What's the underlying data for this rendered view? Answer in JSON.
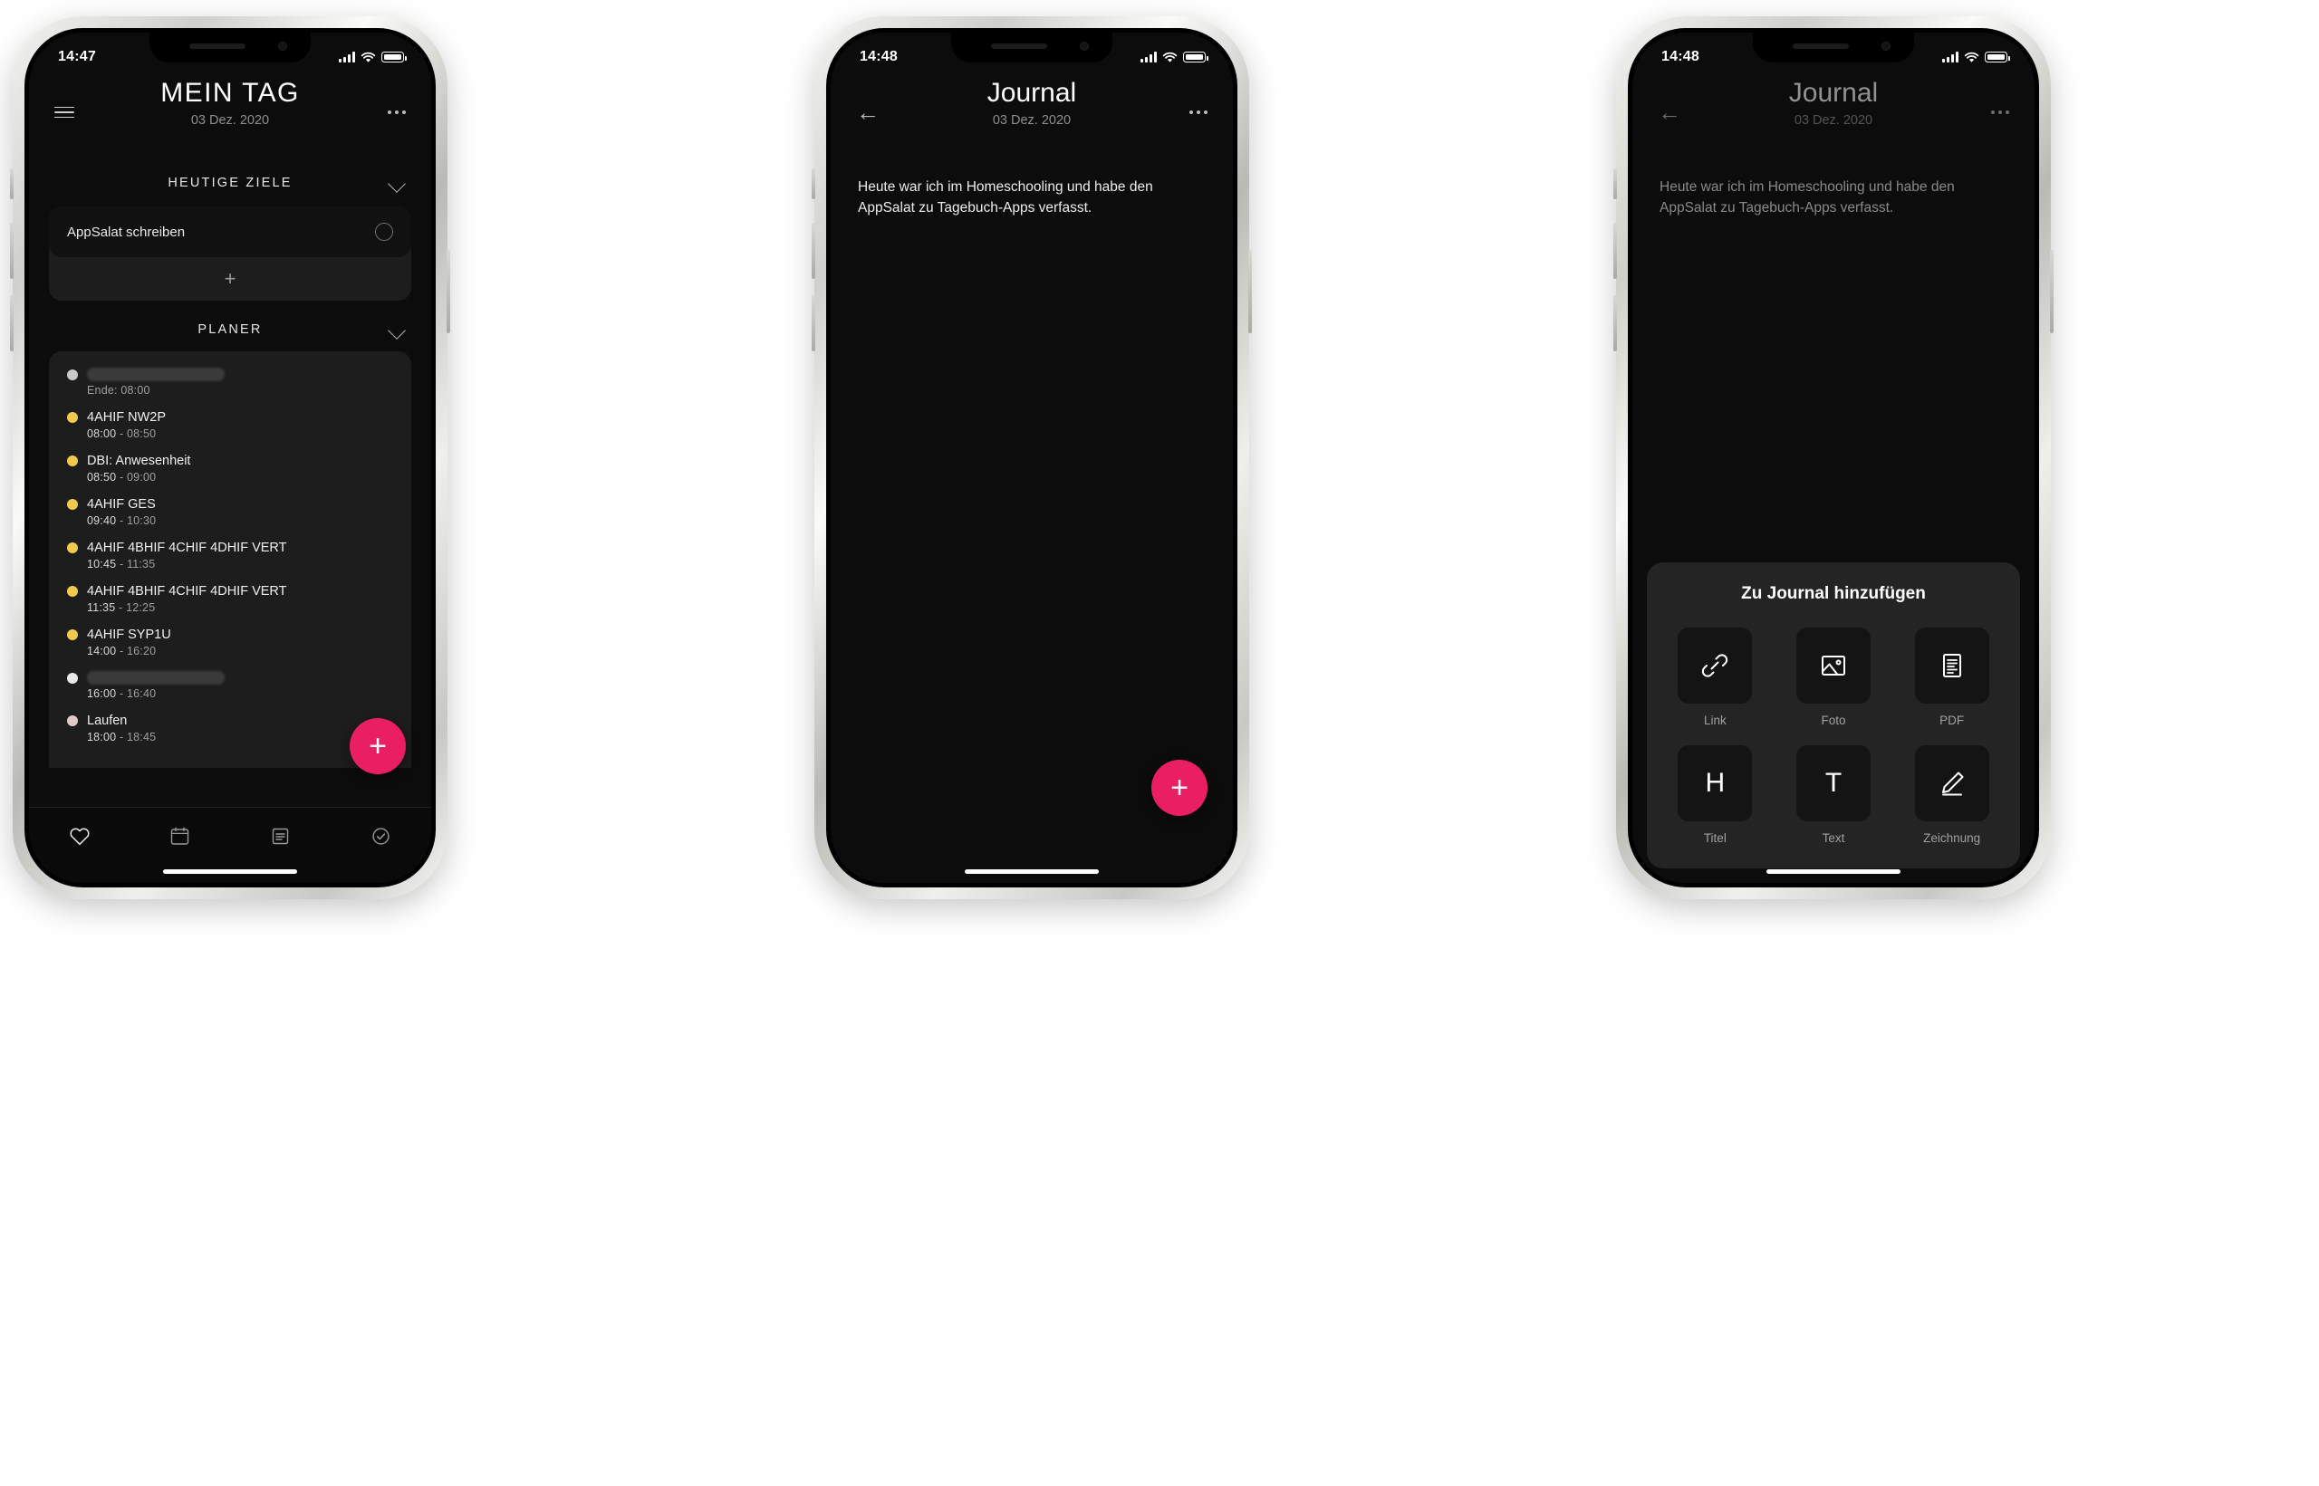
{
  "phones": [
    {
      "id": "phone-mein-tag",
      "status": {
        "time": "14:47",
        "signal_icon": "cellular-bars-icon",
        "wifi_icon": "wifi-icon",
        "battery_icon": "battery-icon"
      },
      "nav": {
        "left_icon": "hamburger-menu-icon",
        "title": "MEIN TAG",
        "subtitle": "03 Dez. 2020",
        "right_icon": "more-options-icon"
      },
      "sections": [
        {
          "key": "goals",
          "title": "HEUTIGE ZIELE",
          "collapse_icon": "chevron-down-icon"
        },
        {
          "key": "planner",
          "title": "PLANER",
          "collapse_icon": "chevron-down-icon"
        }
      ],
      "goals": {
        "items": [
          {
            "label": "AppSalat schreiben",
            "checkbox_icon": "circle-unchecked-icon",
            "done": false
          }
        ],
        "add_label": "+"
      },
      "planner": {
        "events": [
          {
            "title": "",
            "redacted": true,
            "redacted_width": "wide",
            "time": "Ende: 08:00",
            "start": "",
            "end": "",
            "dot": "#c9c9c9",
            "time_plain": true
          },
          {
            "title": "4AHIF NW2P",
            "redacted": false,
            "start": "08:00",
            "end": "08:50",
            "dot": "#f2c94c"
          },
          {
            "title": "DBI: Anwesenheit",
            "redacted": false,
            "start": "08:50",
            "end": "09:00",
            "dot": "#f2c94c"
          },
          {
            "title": "4AHIF GES",
            "redacted": false,
            "start": "09:40",
            "end": "10:30",
            "dot": "#f2c94c"
          },
          {
            "title": "4AHIF 4BHIF 4CHIF 4DHIF VERT",
            "redacted": false,
            "start": "10:45",
            "end": "11:35",
            "dot": "#f2c94c"
          },
          {
            "title": "4AHIF 4BHIF 4CHIF 4DHIF VERT",
            "redacted": false,
            "start": "11:35",
            "end": "12:25",
            "dot": "#f2c94c"
          },
          {
            "title": "4AHIF SYP1U",
            "redacted": false,
            "start": "14:00",
            "end": "16:20",
            "dot": "#f2c94c"
          },
          {
            "title": "",
            "redacted": true,
            "redacted_width": "wide",
            "start": "16:00",
            "end": "16:40",
            "dot": "#e8e8e8"
          },
          {
            "title": "Laufen",
            "redacted": false,
            "start": "18:00",
            "end": "18:45",
            "dot": "#e2c9c9"
          }
        ]
      },
      "fab": {
        "label": "+",
        "color": "#e91e63"
      },
      "tabs": [
        {
          "icon": "heart-icon",
          "name": "favorites"
        },
        {
          "icon": "calendar-icon",
          "name": "calendar"
        },
        {
          "icon": "journal-icon",
          "name": "journal"
        },
        {
          "icon": "check-circle-icon",
          "name": "tasks"
        }
      ]
    },
    {
      "id": "phone-journal",
      "status": {
        "time": "14:48",
        "signal_icon": "cellular-bars-icon",
        "wifi_icon": "wifi-icon",
        "battery_icon": "battery-icon"
      },
      "nav": {
        "left_icon": "back-arrow-icon",
        "title": "Journal",
        "subtitle": "03 Dez. 2020",
        "right_icon": "more-options-icon"
      },
      "body_text": "Heute war ich im Homeschooling und habe den AppSalat zu Tagebuch-Apps verfasst.",
      "fab": {
        "label": "+",
        "color": "#e91e63"
      }
    },
    {
      "id": "phone-journal-sheet",
      "status": {
        "time": "14:48",
        "signal_icon": "cellular-bars-icon",
        "wifi_icon": "wifi-icon",
        "battery_icon": "battery-icon"
      },
      "nav": {
        "left_icon": "back-arrow-icon",
        "title": "Journal",
        "subtitle": "03 Dez. 2020",
        "right_icon": "more-options-icon"
      },
      "body_text": "Heute war ich im Homeschooling und habe den AppSalat zu Tagebuch-Apps verfasst.",
      "sheet": {
        "title": "Zu Journal hinzufügen",
        "items": [
          {
            "label": "Link",
            "icon": "link-icon"
          },
          {
            "label": "Foto",
            "icon": "image-icon"
          },
          {
            "label": "PDF",
            "icon": "pdf-document-icon"
          },
          {
            "label": "Titel",
            "icon": "heading-h-icon"
          },
          {
            "label": "Text",
            "icon": "text-t-icon"
          },
          {
            "label": "Zeichnung",
            "icon": "pencil-draw-icon"
          }
        ]
      }
    }
  ],
  "theme": {
    "accent": "#e91e63",
    "event_dot_default": "#f2c94c",
    "screen_bg": "#0c0c0c",
    "card_bg": "#1d1d1d",
    "sheet_bg": "#242424"
  }
}
